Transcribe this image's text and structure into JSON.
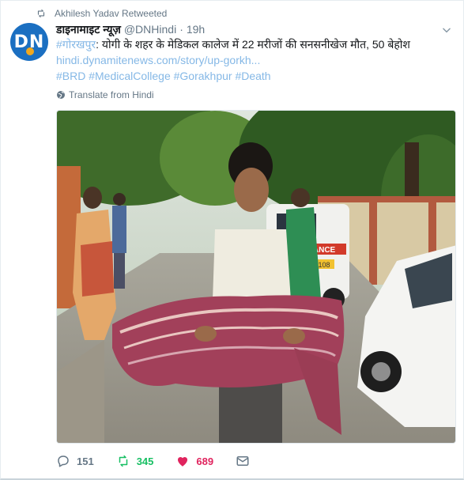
{
  "retweet_banner": {
    "text": "Akhilesh Yadav Retweeted",
    "icon": "retweet-icon"
  },
  "author": {
    "avatar_text": "DN",
    "display_name": "डाइनामाइट न्यूज़",
    "handle": "@DNHindi",
    "separator": "·",
    "time": "19h"
  },
  "tweet": {
    "hashtag_prefix": "#गोरखपुर",
    "body": ": योगी के शहर के मेडिकल कालेज में 22 मरीजों की सनसनीखेज मौत, 50 बेहोश",
    "link": "hindi.dynamitenews.com/story/up-gorkh...",
    "hashtags": "#BRD #MedicalCollege #Gorakhpur #Death"
  },
  "translate_label": "Translate from Hindi",
  "photo": {
    "ambulance_label": "AMBULANCE",
    "plate": "108"
  },
  "actions": {
    "reply_count": "151",
    "retweet_count": "345",
    "like_count": "689"
  },
  "colors": {
    "link": "#85b8e6",
    "retweet_green": "#17bf63",
    "like_red": "#e0245e",
    "muted": "#657786",
    "avatar_blue": "#1b6fc1"
  }
}
